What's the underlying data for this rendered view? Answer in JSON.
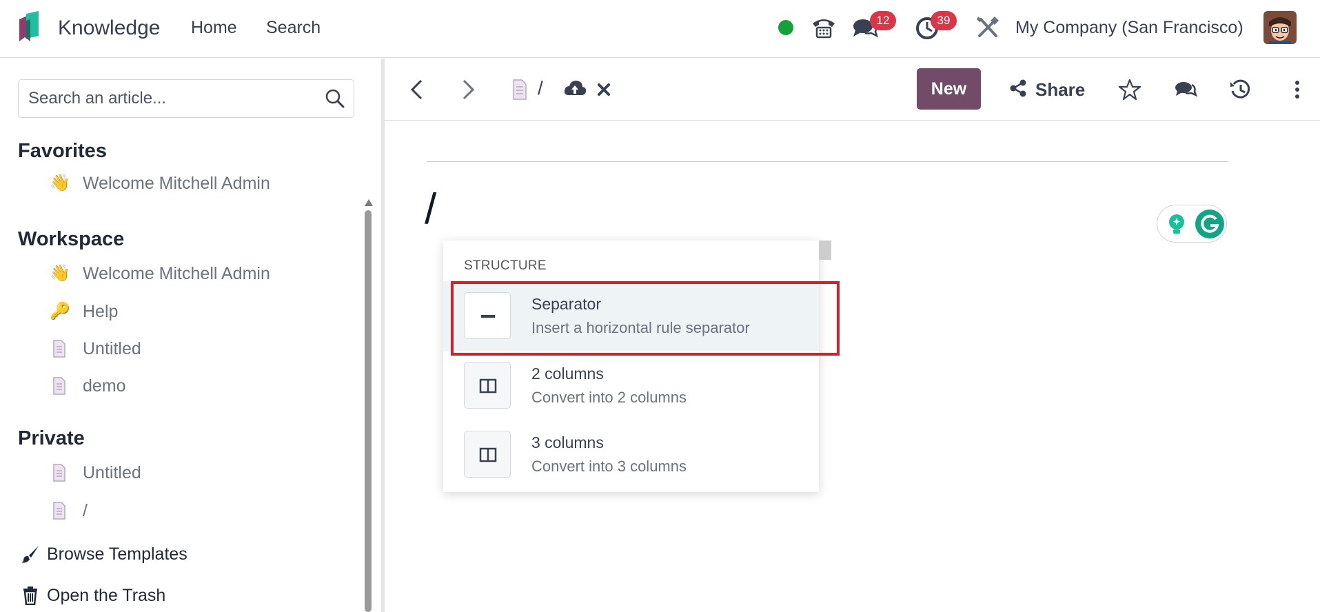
{
  "app": {
    "name": "Knowledge",
    "nav": [
      "Home",
      "Search"
    ],
    "company": "My Company (San Francisco)",
    "messages_badge": "12",
    "activities_badge": "39"
  },
  "sidebar": {
    "search_placeholder": "Search an article...",
    "favorites": {
      "title": "Favorites",
      "items": [
        {
          "icon": "👋",
          "label": "Welcome Mitchell Admin"
        }
      ]
    },
    "workspace": {
      "title": "Workspace",
      "items": [
        {
          "icon": "👋",
          "label": "Welcome Mitchell Admin"
        },
        {
          "icon": "🔑",
          "label": "Help"
        },
        {
          "icon": "document-icon",
          "label": "Untitled"
        },
        {
          "icon": "document-icon",
          "label": "demo"
        }
      ]
    },
    "private": {
      "title": "Private",
      "items": [
        {
          "icon": "document-icon",
          "label": "Untitled"
        },
        {
          "icon": "document-icon",
          "label": "/"
        }
      ]
    },
    "browse_templates": "Browse Templates",
    "open_trash": "Open the Trash"
  },
  "toolbar": {
    "breadcrumb_title": "/",
    "new_label": "New",
    "share_label": "Share"
  },
  "editor": {
    "content": "/"
  },
  "command_palette": {
    "category": "STRUCTURE",
    "commands": [
      {
        "title": "Separator",
        "description": "Insert a horizontal rule separator",
        "active": true
      },
      {
        "title": "2 columns",
        "description": "Convert into 2 columns",
        "active": false
      },
      {
        "title": "3 columns",
        "description": "Convert into 3 columns",
        "active": false
      }
    ]
  },
  "colors": {
    "brand": "#714b67",
    "badge": "#dc3545",
    "status_online": "#15a13a",
    "highlight": "#d0212d"
  }
}
